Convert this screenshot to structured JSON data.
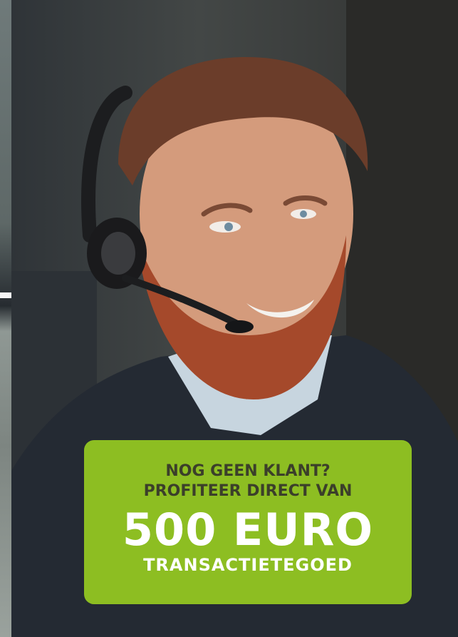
{
  "promo": {
    "line1": "NOG GEEN KLANT?",
    "line2": "PROFITEER DIRECT VAN",
    "amount": "500 EURO",
    "subtitle": "TRANSACTIETEGOED"
  },
  "colors": {
    "promo_bg": "#8DBE22",
    "promo_text_dark": "#3B3F2A",
    "promo_text_light": "#FFFFFF"
  }
}
